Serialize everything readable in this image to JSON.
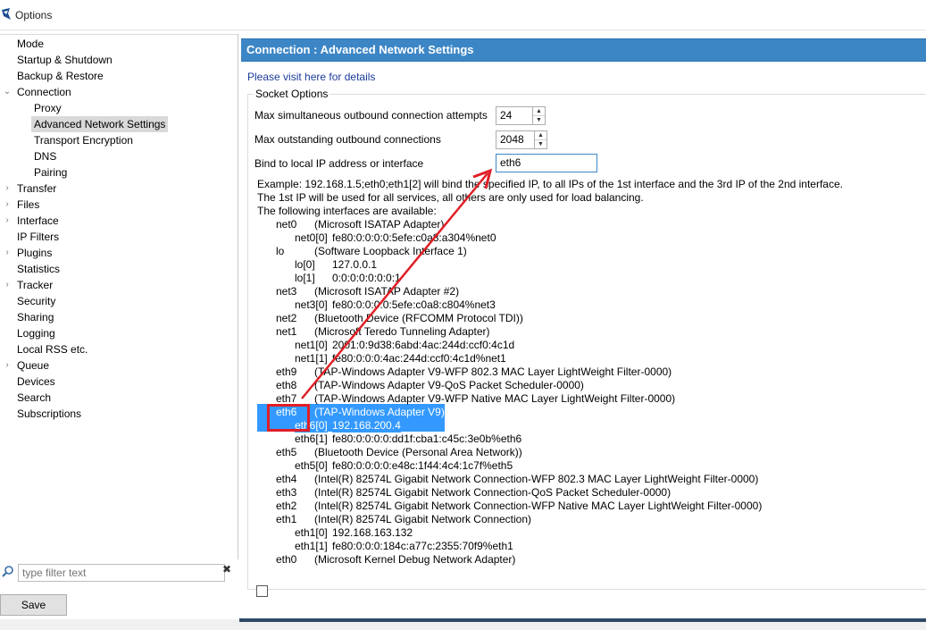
{
  "window": {
    "title": "Options"
  },
  "sidebar": {
    "items": [
      {
        "label": "Mode",
        "indent": 0,
        "expander": ""
      },
      {
        "label": "Startup & Shutdown",
        "indent": 0,
        "expander": ""
      },
      {
        "label": "Backup & Restore",
        "indent": 0,
        "expander": ""
      },
      {
        "label": "Connection",
        "indent": 0,
        "expander": "expanded"
      },
      {
        "label": "Proxy",
        "indent": 1,
        "expander": ""
      },
      {
        "label": "Advanced Network Settings",
        "indent": 1,
        "expander": "",
        "selected": true
      },
      {
        "label": "Transport Encryption",
        "indent": 1,
        "expander": ""
      },
      {
        "label": "DNS",
        "indent": 1,
        "expander": ""
      },
      {
        "label": "Pairing",
        "indent": 1,
        "expander": ""
      },
      {
        "label": "Transfer",
        "indent": 0,
        "expander": "collapsed"
      },
      {
        "label": "Files",
        "indent": 0,
        "expander": "collapsed"
      },
      {
        "label": "Interface",
        "indent": 0,
        "expander": "collapsed"
      },
      {
        "label": "IP Filters",
        "indent": 0,
        "expander": ""
      },
      {
        "label": "Plugins",
        "indent": 0,
        "expander": "collapsed"
      },
      {
        "label": "Statistics",
        "indent": 0,
        "expander": ""
      },
      {
        "label": "Tracker",
        "indent": 0,
        "expander": "collapsed"
      },
      {
        "label": "Security",
        "indent": 0,
        "expander": ""
      },
      {
        "label": "Sharing",
        "indent": 0,
        "expander": ""
      },
      {
        "label": "Logging",
        "indent": 0,
        "expander": ""
      },
      {
        "label": "Local RSS etc.",
        "indent": 0,
        "expander": ""
      },
      {
        "label": "Queue",
        "indent": 0,
        "expander": "collapsed"
      },
      {
        "label": "Devices",
        "indent": 0,
        "expander": ""
      },
      {
        "label": "Search",
        "indent": 0,
        "expander": ""
      },
      {
        "label": "Subscriptions",
        "indent": 0,
        "expander": ""
      }
    ],
    "filter_placeholder": "type filter text",
    "filter_clear": "✖"
  },
  "footer": {
    "save_label": "Save"
  },
  "panel": {
    "header": "Connection : Advanced Network Settings",
    "details_link": "Please visit here for details",
    "group_title": "Socket Options",
    "max_attempts_label": "Max simultaneous outbound connection attempts",
    "max_attempts_value": "24",
    "max_outstanding_label": "Max outstanding outbound connections",
    "max_outstanding_value": "2048",
    "bind_label": "Bind to local IP address or interface",
    "bind_value": "eth6",
    "info_lines": [
      {
        "indent": 0,
        "name": "Example: 192.168.1.5;eth0;eth1[2] will bind the specified IP, to all IPs of the 1st interface and the 3rd IP of the 2nd interface.",
        "desc": ""
      },
      {
        "indent": 0,
        "name": "The 1st IP will be used for all services, all others are only used for load balancing.",
        "desc": ""
      },
      {
        "indent": 0,
        "name": "The following interfaces are available:",
        "desc": ""
      },
      {
        "indent": 1,
        "name": "net0",
        "desc": "(Microsoft ISATAP Adapter)"
      },
      {
        "indent": 2,
        "name": "net0[0]",
        "desc": "fe80:0:0:0:0:5efe:c0a8:a304%net0"
      },
      {
        "indent": 1,
        "name": "lo",
        "desc": "(Software Loopback Interface 1)"
      },
      {
        "indent": 2,
        "name": "lo[0]",
        "desc": "127.0.0.1"
      },
      {
        "indent": 2,
        "name": "lo[1]",
        "desc": "0:0:0:0:0:0:0:1"
      },
      {
        "indent": 1,
        "name": "net3",
        "desc": "(Microsoft ISATAP Adapter #2)"
      },
      {
        "indent": 2,
        "name": "net3[0]",
        "desc": "fe80:0:0:0:0:5efe:c0a8:c804%net3"
      },
      {
        "indent": 1,
        "name": "net2",
        "desc": "(Bluetooth Device (RFCOMM Protocol TDI))"
      },
      {
        "indent": 1,
        "name": "net1",
        "desc": "(Microsoft Teredo Tunneling Adapter)"
      },
      {
        "indent": 2,
        "name": "net1[0]",
        "desc": "2001:0:9d38:6abd:4ac:244d:ccf0:4c1d"
      },
      {
        "indent": 2,
        "name": "net1[1]",
        "desc": "fe80:0:0:0:4ac:244d:ccf0:4c1d%net1"
      },
      {
        "indent": 1,
        "name": "eth9",
        "desc": "(TAP-Windows Adapter V9-WFP 802.3 MAC Layer LightWeight Filter-0000)"
      },
      {
        "indent": 1,
        "name": "eth8",
        "desc": "(TAP-Windows Adapter V9-QoS Packet Scheduler-0000)"
      },
      {
        "indent": 1,
        "name": "eth7",
        "desc": "(TAP-Windows Adapter V9-WFP Native MAC Layer LightWeight Filter-0000)"
      },
      {
        "indent": 1,
        "name": "eth6",
        "desc": "(TAP-Windows Adapter V9)",
        "highlight": true
      },
      {
        "indent": 2,
        "name": "eth6[0]",
        "desc": "192.168.200.4",
        "highlight": true
      },
      {
        "indent": 2,
        "name": "eth6[1]",
        "desc": "fe80:0:0:0:0:dd1f:cba1:c45c:3e0b%eth6"
      },
      {
        "indent": 1,
        "name": "eth5",
        "desc": "(Bluetooth Device (Personal Area Network))"
      },
      {
        "indent": 2,
        "name": "eth5[0]",
        "desc": "fe80:0:0:0:0:e48c:1f44:4c4:1c7f%eth5"
      },
      {
        "indent": 1,
        "name": "eth4",
        "desc": "(Intel(R) 82574L Gigabit Network Connection-WFP 802.3 MAC Layer LightWeight Filter-0000)"
      },
      {
        "indent": 1,
        "name": "eth3",
        "desc": "(Intel(R) 82574L Gigabit Network Connection-QoS Packet Scheduler-0000)"
      },
      {
        "indent": 1,
        "name": "eth2",
        "desc": "(Intel(R) 82574L Gigabit Network Connection-WFP Native MAC Layer LightWeight Filter-0000)"
      },
      {
        "indent": 1,
        "name": "eth1",
        "desc": "(Intel(R) 82574L Gigabit Network Connection)"
      },
      {
        "indent": 2,
        "name": "eth1[0]",
        "desc": "192.168.163.132"
      },
      {
        "indent": 2,
        "name": "eth1[1]",
        "desc": "fe80:0:0:0:184c:a77c:2355:70f9%eth1"
      },
      {
        "indent": 1,
        "name": "eth0",
        "desc": "(Microsoft Kernel Debug Network Adapter)"
      }
    ]
  },
  "colors": {
    "header_bg": "#3d86c6",
    "highlight": "#3399ff",
    "annotation": "#e01f26",
    "link": "#1a3a9c"
  }
}
